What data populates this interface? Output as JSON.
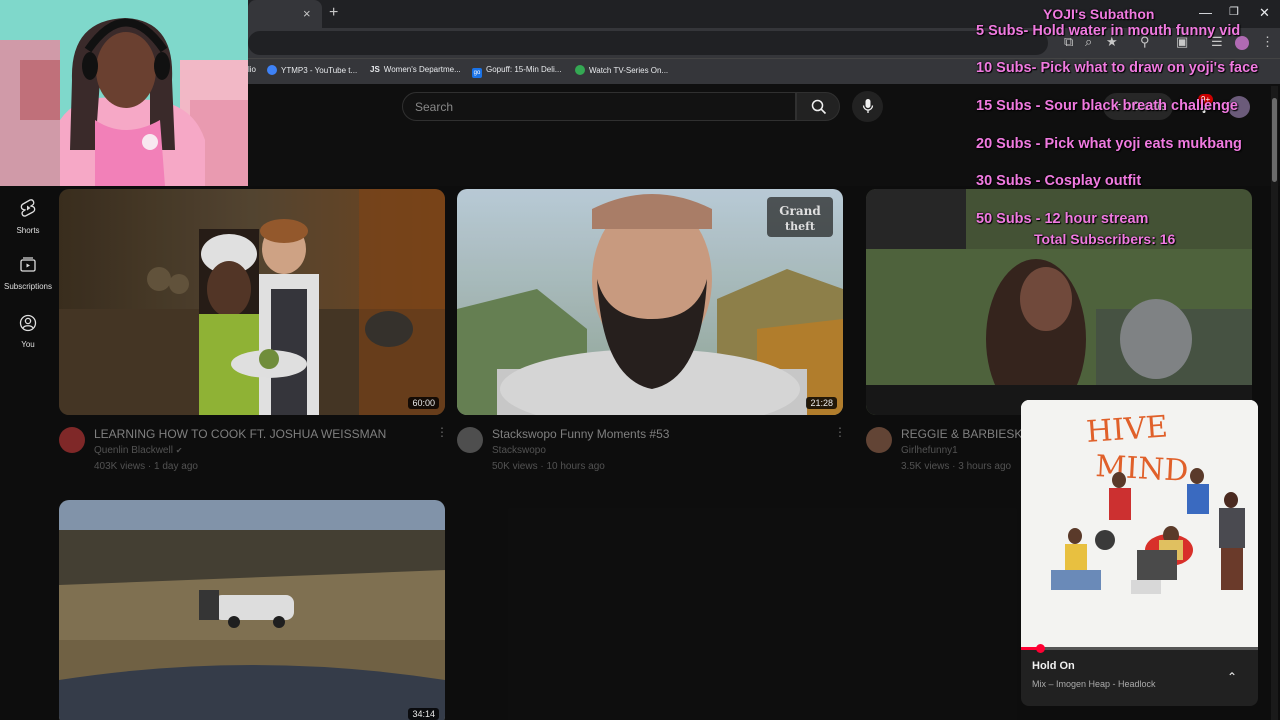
{
  "browser": {
    "bookmarks": [
      {
        "label": "lio",
        "color": "#6a6a6a"
      },
      {
        "label": "YTMP3 - YouTube t...",
        "color": "#3e82f7"
      },
      {
        "label": "Women's Departme...",
        "color": "#222222"
      },
      {
        "label": "Gopuff: 15-Min Deli...",
        "color": "#1a73e8"
      },
      {
        "label": "Watch TV-Series On...",
        "color": "#34a853"
      }
    ],
    "bookmark_js_prefix": "JS",
    "bookmark_gopuff_prefix": "go",
    "tab_close": "×",
    "new_tab": "+"
  },
  "search": {
    "placeholder": "Search"
  },
  "header": {
    "create_label": "Create",
    "notification_count": "9+"
  },
  "sidebar": {
    "items": [
      {
        "label": "Shorts",
        "icon": "shorts-icon"
      },
      {
        "label": "Subscriptions",
        "icon": "subscriptions-icon"
      },
      {
        "label": "You",
        "icon": "you-icon"
      }
    ]
  },
  "videos": [
    {
      "title": "LEARNING HOW TO COOK FT. JOSHUA WEISSMAN",
      "channel": "Quenlin Blackwell",
      "verified": true,
      "views": "403K views",
      "age": "1 day ago",
      "duration": "60:00",
      "avatar_color": "#8a2c2c"
    },
    {
      "title": "Stackswopo Funny Moments #53",
      "channel": "Stackswopo",
      "verified": false,
      "views": "50K views",
      "age": "10 hours ago",
      "duration": "21:28",
      "avatar_color": "#555555"
    },
    {
      "title": "REGGIE & BARBIESKIE",
      "channel": "Girlhefunny1",
      "verified": false,
      "views": "3.5K views",
      "age": "3 hours ago",
      "duration": "",
      "avatar_color": "#6b4a3a"
    },
    {
      "title": "",
      "channel": "",
      "verified": false,
      "views": "",
      "age": "",
      "duration": "34:14",
      "avatar_color": "#333333"
    }
  ],
  "overlay": {
    "title": "YOJI's Subathon",
    "goals": [
      "5 Subs- Hold water in mouth funny vid",
      "10 Subs- Pick what to draw on yoji's face",
      "15 Subs - Sour black breath challenge",
      "20 Subs - Pick what yoji eats mukbang",
      "30 Subs - Cosplay outfit",
      "50 Subs - 12 hour stream"
    ],
    "total": "Total Subscribers: 16"
  },
  "miniplayer": {
    "title": "Hold On",
    "subtitle": "Mix – Imogen Heap - Headlock",
    "album_text": "HIVE MIND",
    "progress": 0.08
  },
  "colors": {
    "accent": "#ff0033",
    "overlay_text": "#f07ae0"
  }
}
